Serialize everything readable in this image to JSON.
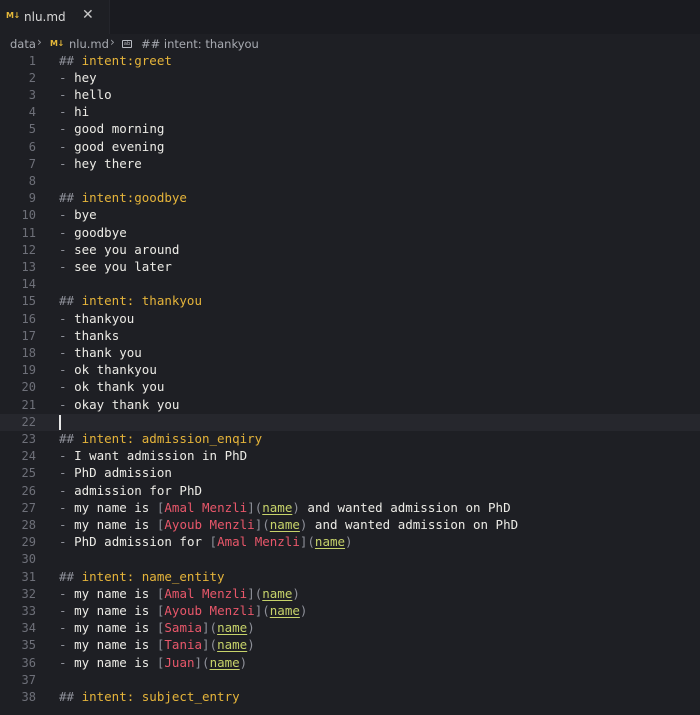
{
  "tab": {
    "icon": "markdown-icon",
    "icon_text": "M↓",
    "label": "nlu.md",
    "close": "✕"
  },
  "breadcrumb": {
    "folder": "data",
    "file": "nlu.md",
    "section": "## intent: thankyou"
  },
  "colors": {
    "heading": "#e5b43a",
    "entity": "#e8576a",
    "link": "#c7d36a",
    "text": "#ecebe6",
    "punct": "#8e9099",
    "background": "#1e1f24"
  },
  "lines": [
    {
      "n": "1",
      "tokens": [
        {
          "t": "## ",
          "c": "hash"
        },
        {
          "t": "intent:greet",
          "c": "head"
        }
      ]
    },
    {
      "n": "2",
      "tokens": [
        {
          "t": "- ",
          "c": "dash"
        },
        {
          "t": "hey",
          "c": "plain"
        }
      ]
    },
    {
      "n": "3",
      "tokens": [
        {
          "t": "- ",
          "c": "dash"
        },
        {
          "t": "hello",
          "c": "plain"
        }
      ]
    },
    {
      "n": "4",
      "tokens": [
        {
          "t": "- ",
          "c": "dash"
        },
        {
          "t": "hi",
          "c": "plain"
        }
      ]
    },
    {
      "n": "5",
      "tokens": [
        {
          "t": "- ",
          "c": "dash"
        },
        {
          "t": "good morning",
          "c": "plain"
        }
      ]
    },
    {
      "n": "6",
      "tokens": [
        {
          "t": "- ",
          "c": "dash"
        },
        {
          "t": "good evening",
          "c": "plain"
        }
      ]
    },
    {
      "n": "7",
      "tokens": [
        {
          "t": "- ",
          "c": "dash"
        },
        {
          "t": "hey there",
          "c": "plain"
        }
      ]
    },
    {
      "n": "8",
      "tokens": []
    },
    {
      "n": "9",
      "tokens": [
        {
          "t": "## ",
          "c": "hash"
        },
        {
          "t": "intent:goodbye",
          "c": "head"
        }
      ]
    },
    {
      "n": "10",
      "tokens": [
        {
          "t": "- ",
          "c": "dash"
        },
        {
          "t": "bye",
          "c": "plain"
        }
      ]
    },
    {
      "n": "11",
      "tokens": [
        {
          "t": "- ",
          "c": "dash"
        },
        {
          "t": "goodbye",
          "c": "plain"
        }
      ]
    },
    {
      "n": "12",
      "tokens": [
        {
          "t": "- ",
          "c": "dash"
        },
        {
          "t": "see you around",
          "c": "plain"
        }
      ]
    },
    {
      "n": "13",
      "tokens": [
        {
          "t": "- ",
          "c": "dash"
        },
        {
          "t": "see you later",
          "c": "plain"
        }
      ]
    },
    {
      "n": "14",
      "tokens": []
    },
    {
      "n": "15",
      "tokens": [
        {
          "t": "## ",
          "c": "hash"
        },
        {
          "t": "intent: thankyou",
          "c": "head"
        }
      ]
    },
    {
      "n": "16",
      "tokens": [
        {
          "t": "- ",
          "c": "dash"
        },
        {
          "t": "thankyou",
          "c": "plain"
        }
      ]
    },
    {
      "n": "17",
      "tokens": [
        {
          "t": "- ",
          "c": "dash"
        },
        {
          "t": "thanks",
          "c": "plain"
        }
      ]
    },
    {
      "n": "18",
      "tokens": [
        {
          "t": "- ",
          "c": "dash"
        },
        {
          "t": "thank you",
          "c": "plain"
        }
      ]
    },
    {
      "n": "19",
      "tokens": [
        {
          "t": "- ",
          "c": "dash"
        },
        {
          "t": "ok thankyou",
          "c": "plain"
        }
      ]
    },
    {
      "n": "20",
      "tokens": [
        {
          "t": "- ",
          "c": "dash"
        },
        {
          "t": "ok thank you",
          "c": "plain"
        }
      ]
    },
    {
      "n": "21",
      "tokens": [
        {
          "t": "- ",
          "c": "dash"
        },
        {
          "t": "okay thank you",
          "c": "plain"
        }
      ]
    },
    {
      "n": "22",
      "tokens": [],
      "active": true
    },
    {
      "n": "23",
      "tokens": [
        {
          "t": "## ",
          "c": "hash"
        },
        {
          "t": "intent: admission_enqiry",
          "c": "head"
        }
      ]
    },
    {
      "n": "24",
      "tokens": [
        {
          "t": "- ",
          "c": "dash"
        },
        {
          "t": "I want admission in PhD",
          "c": "plain"
        }
      ]
    },
    {
      "n": "25",
      "tokens": [
        {
          "t": "- ",
          "c": "dash"
        },
        {
          "t": "PhD admission",
          "c": "plain"
        }
      ]
    },
    {
      "n": "26",
      "tokens": [
        {
          "t": "- ",
          "c": "dash"
        },
        {
          "t": "admission for PhD",
          "c": "plain"
        }
      ]
    },
    {
      "n": "27",
      "tokens": [
        {
          "t": "- ",
          "c": "dash"
        },
        {
          "t": "my name is ",
          "c": "plain"
        },
        {
          "t": "[",
          "c": "brk"
        },
        {
          "t": "Amal Menzli",
          "c": "ent"
        },
        {
          "t": "](",
          "c": "brk"
        },
        {
          "t": "name",
          "c": "link"
        },
        {
          "t": ")",
          "c": "brk"
        },
        {
          "t": " and wanted admission on PhD",
          "c": "plain"
        }
      ]
    },
    {
      "n": "28",
      "tokens": [
        {
          "t": "- ",
          "c": "dash"
        },
        {
          "t": "my name is ",
          "c": "plain"
        },
        {
          "t": "[",
          "c": "brk"
        },
        {
          "t": "Ayoub Menzli",
          "c": "ent"
        },
        {
          "t": "](",
          "c": "brk"
        },
        {
          "t": "name",
          "c": "link"
        },
        {
          "t": ")",
          "c": "brk"
        },
        {
          "t": " and wanted admission on PhD",
          "c": "plain"
        }
      ]
    },
    {
      "n": "29",
      "tokens": [
        {
          "t": "- ",
          "c": "dash"
        },
        {
          "t": "PhD admission for ",
          "c": "plain"
        },
        {
          "t": "[",
          "c": "brk"
        },
        {
          "t": "Amal Menzli",
          "c": "ent"
        },
        {
          "t": "](",
          "c": "brk"
        },
        {
          "t": "name",
          "c": "link"
        },
        {
          "t": ")",
          "c": "brk"
        }
      ]
    },
    {
      "n": "30",
      "tokens": []
    },
    {
      "n": "31",
      "tokens": [
        {
          "t": "## ",
          "c": "hash"
        },
        {
          "t": "intent: name_entity",
          "c": "head"
        }
      ]
    },
    {
      "n": "32",
      "tokens": [
        {
          "t": "- ",
          "c": "dash"
        },
        {
          "t": "my name is ",
          "c": "plain"
        },
        {
          "t": "[",
          "c": "brk"
        },
        {
          "t": "Amal Menzli",
          "c": "ent"
        },
        {
          "t": "](",
          "c": "brk"
        },
        {
          "t": "name",
          "c": "link"
        },
        {
          "t": ")",
          "c": "brk"
        }
      ]
    },
    {
      "n": "33",
      "tokens": [
        {
          "t": "- ",
          "c": "dash"
        },
        {
          "t": "my name is ",
          "c": "plain"
        },
        {
          "t": "[",
          "c": "brk"
        },
        {
          "t": "Ayoub Menzli",
          "c": "ent"
        },
        {
          "t": "](",
          "c": "brk"
        },
        {
          "t": "name",
          "c": "link"
        },
        {
          "t": ")",
          "c": "brk"
        }
      ]
    },
    {
      "n": "34",
      "tokens": [
        {
          "t": "- ",
          "c": "dash"
        },
        {
          "t": "my name is ",
          "c": "plain"
        },
        {
          "t": "[",
          "c": "brk"
        },
        {
          "t": "Samia",
          "c": "ent"
        },
        {
          "t": "](",
          "c": "brk"
        },
        {
          "t": "name",
          "c": "link"
        },
        {
          "t": ")",
          "c": "brk"
        }
      ]
    },
    {
      "n": "35",
      "tokens": [
        {
          "t": "- ",
          "c": "dash"
        },
        {
          "t": "my name is ",
          "c": "plain"
        },
        {
          "t": "[",
          "c": "brk"
        },
        {
          "t": "Tania",
          "c": "ent"
        },
        {
          "t": "](",
          "c": "brk"
        },
        {
          "t": "name",
          "c": "link"
        },
        {
          "t": ")",
          "c": "brk"
        }
      ]
    },
    {
      "n": "36",
      "tokens": [
        {
          "t": "- ",
          "c": "dash"
        },
        {
          "t": "my name is ",
          "c": "plain"
        },
        {
          "t": "[",
          "c": "brk"
        },
        {
          "t": "Juan",
          "c": "ent"
        },
        {
          "t": "](",
          "c": "brk"
        },
        {
          "t": "name",
          "c": "link"
        },
        {
          "t": ")",
          "c": "brk"
        }
      ]
    },
    {
      "n": "37",
      "tokens": []
    },
    {
      "n": "38",
      "tokens": [
        {
          "t": "## ",
          "c": "hash"
        },
        {
          "t": "intent: subject_entry",
          "c": "head"
        }
      ]
    }
  ]
}
